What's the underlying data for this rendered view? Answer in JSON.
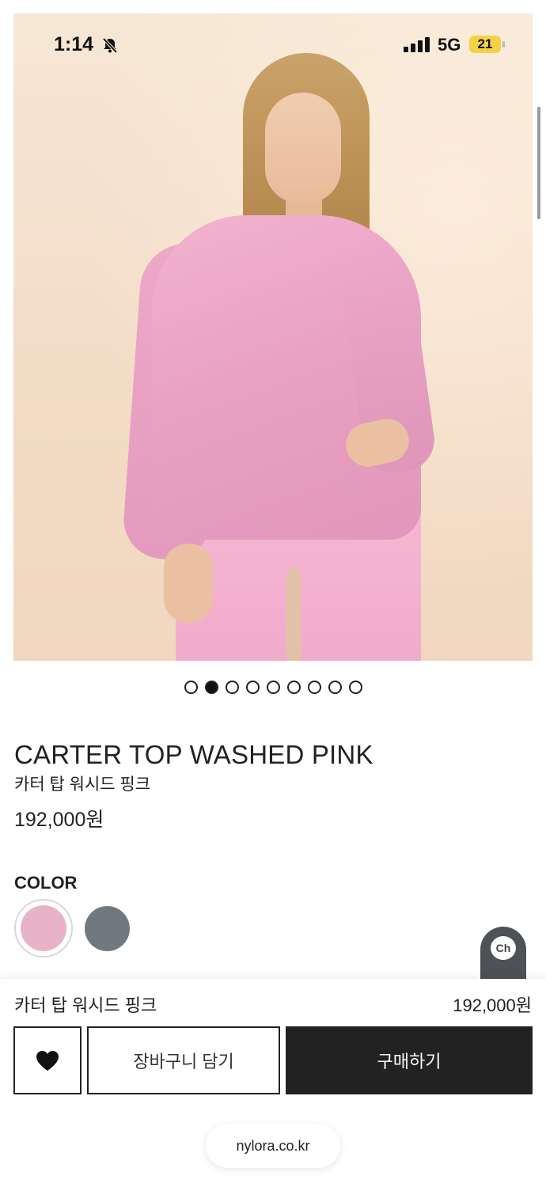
{
  "status_bar": {
    "time": "1:14",
    "network": "5G",
    "battery": "21"
  },
  "gallery": {
    "image_count": 9,
    "active_index": 1
  },
  "product": {
    "title": "CARTER TOP WASHED PINK",
    "subtitle": "카터 탑 워시드 핑크",
    "price": "192,000원"
  },
  "color_section": {
    "label": "COLOR",
    "swatches": [
      {
        "name": "washed-pink",
        "color": "#e8b3c9",
        "selected": true
      },
      {
        "name": "gray",
        "color": "#707880",
        "selected": false
      }
    ]
  },
  "chat": {
    "label": "Ch"
  },
  "purchase_bar": {
    "selected_name": "카터 탑 워시드 핑크",
    "selected_price": "192,000원",
    "cart_label": "장바구니 담기",
    "buy_label": "구매하기"
  },
  "browser": {
    "url": "nylora.co.kr"
  }
}
